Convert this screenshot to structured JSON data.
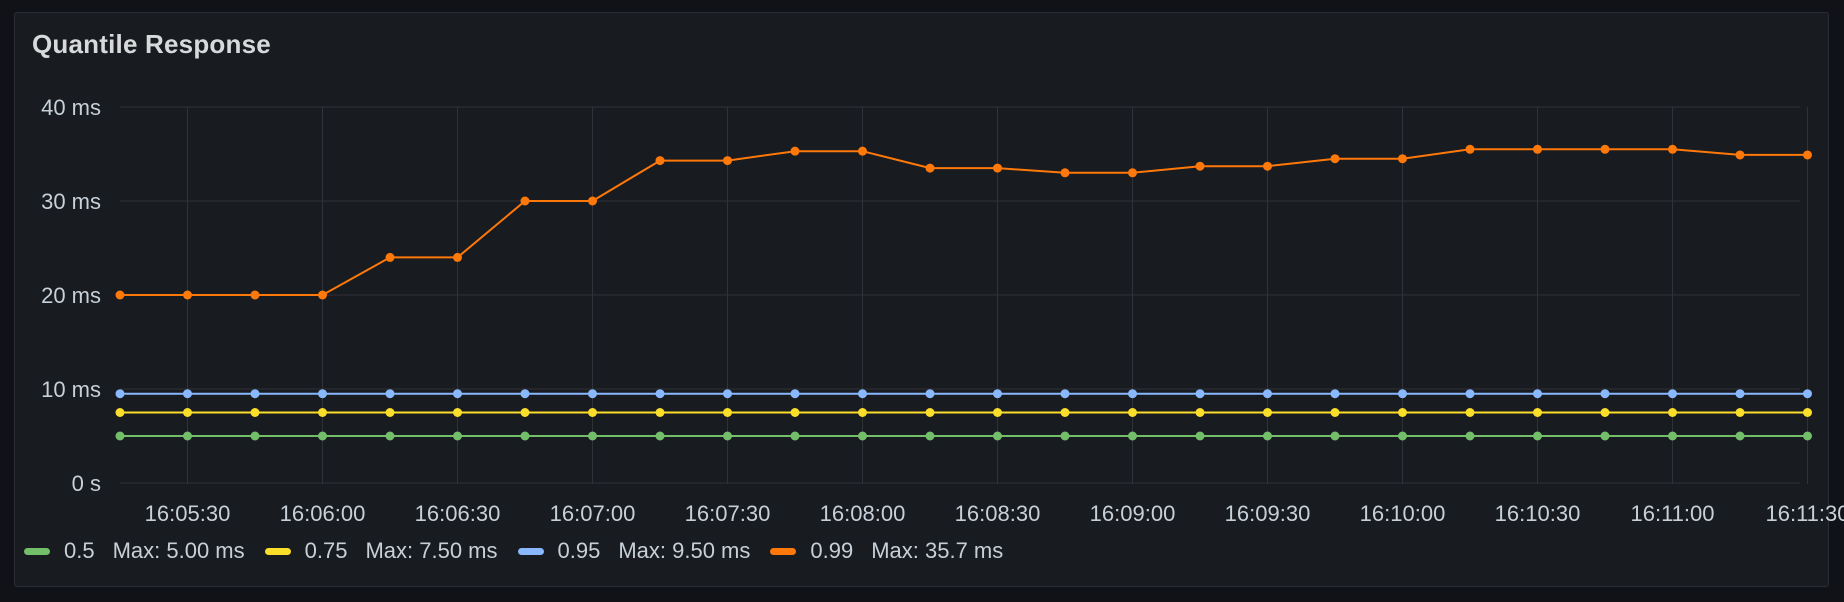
{
  "panel": {
    "title": "Quantile Response"
  },
  "colors": {
    "background": "#181b1f",
    "grid": "#2f3238",
    "text": "#c7d0d9"
  },
  "chart_data": {
    "type": "line",
    "title": "Quantile Response",
    "xlabel": "",
    "ylabel": "",
    "ylim": [
      0,
      40
    ],
    "y_unit": "ms",
    "y_ticks": [
      "0 s",
      "10 ms",
      "20 ms",
      "30 ms",
      "40 ms"
    ],
    "y_tick_values": [
      0,
      10,
      20,
      30,
      40
    ],
    "x_tick_labels": [
      "16:05:30",
      "16:06:00",
      "16:06:30",
      "16:07:00",
      "16:07:30",
      "16:08:00",
      "16:08:30",
      "16:09:00",
      "16:09:30",
      "16:10:00",
      "16:10:30",
      "16:11:00",
      "16:11:30"
    ],
    "x": [
      "16:05:15",
      "16:05:30",
      "16:05:45",
      "16:06:00",
      "16:06:15",
      "16:06:30",
      "16:06:45",
      "16:07:00",
      "16:07:15",
      "16:07:30",
      "16:07:45",
      "16:08:00",
      "16:08:15",
      "16:08:30",
      "16:08:45",
      "16:09:00",
      "16:09:15",
      "16:09:30",
      "16:09:45",
      "16:10:00",
      "16:10:15",
      "16:10:30",
      "16:10:45",
      "16:11:00",
      "16:11:15",
      "16:11:30"
    ],
    "grid": true,
    "legend_position": "bottom",
    "series": [
      {
        "name": "0.5",
        "color": "#73bf69",
        "max_label": "Max: 5.00 ms",
        "values": [
          5,
          5,
          5,
          5,
          5,
          5,
          5,
          5,
          5,
          5,
          5,
          5,
          5,
          5,
          5,
          5,
          5,
          5,
          5,
          5,
          5,
          5,
          5,
          5,
          5,
          5
        ]
      },
      {
        "name": "0.75",
        "color": "#fade2a",
        "max_label": "Max: 7.50 ms",
        "values": [
          7.5,
          7.5,
          7.5,
          7.5,
          7.5,
          7.5,
          7.5,
          7.5,
          7.5,
          7.5,
          7.5,
          7.5,
          7.5,
          7.5,
          7.5,
          7.5,
          7.5,
          7.5,
          7.5,
          7.5,
          7.5,
          7.5,
          7.5,
          7.5,
          7.5,
          7.5
        ]
      },
      {
        "name": "0.95",
        "color": "#8ab8ff",
        "max_label": "Max: 9.50 ms",
        "values": [
          9.5,
          9.5,
          9.5,
          9.5,
          9.5,
          9.5,
          9.5,
          9.5,
          9.5,
          9.5,
          9.5,
          9.5,
          9.5,
          9.5,
          9.5,
          9.5,
          9.5,
          9.5,
          9.5,
          9.5,
          9.5,
          9.5,
          9.5,
          9.5,
          9.5,
          9.5
        ]
      },
      {
        "name": "0.99",
        "color": "#ff780a",
        "max_label": "Max: 35.7 ms",
        "values": [
          20,
          20,
          20,
          20,
          24,
          24,
          30,
          30,
          34.3,
          34.3,
          35.3,
          35.3,
          33.5,
          33.5,
          33,
          33,
          33.7,
          33.7,
          34.5,
          34.5,
          35.5,
          35.5,
          35.5,
          35.5,
          34.9,
          34.9
        ]
      }
    ]
  }
}
